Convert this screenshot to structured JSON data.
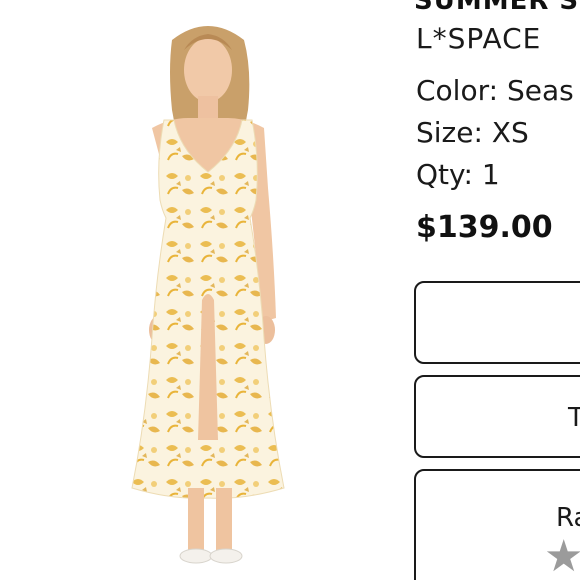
{
  "product": {
    "name": "SUMMER S",
    "brand": "L*SPACE",
    "color_label": "Color: Seas",
    "size_label": "Size: XS",
    "qty_label": "Qty: 1",
    "price": "$139.00"
  },
  "buttons": {
    "first_label": "",
    "second_label": "T",
    "third_label": "Ra",
    "star_icon": "star-icon"
  },
  "colors": {
    "dress_base": "#fbf3df",
    "dress_print": "#e9b43a",
    "border": "#1a1a1a",
    "star": "#9b9b9b"
  }
}
